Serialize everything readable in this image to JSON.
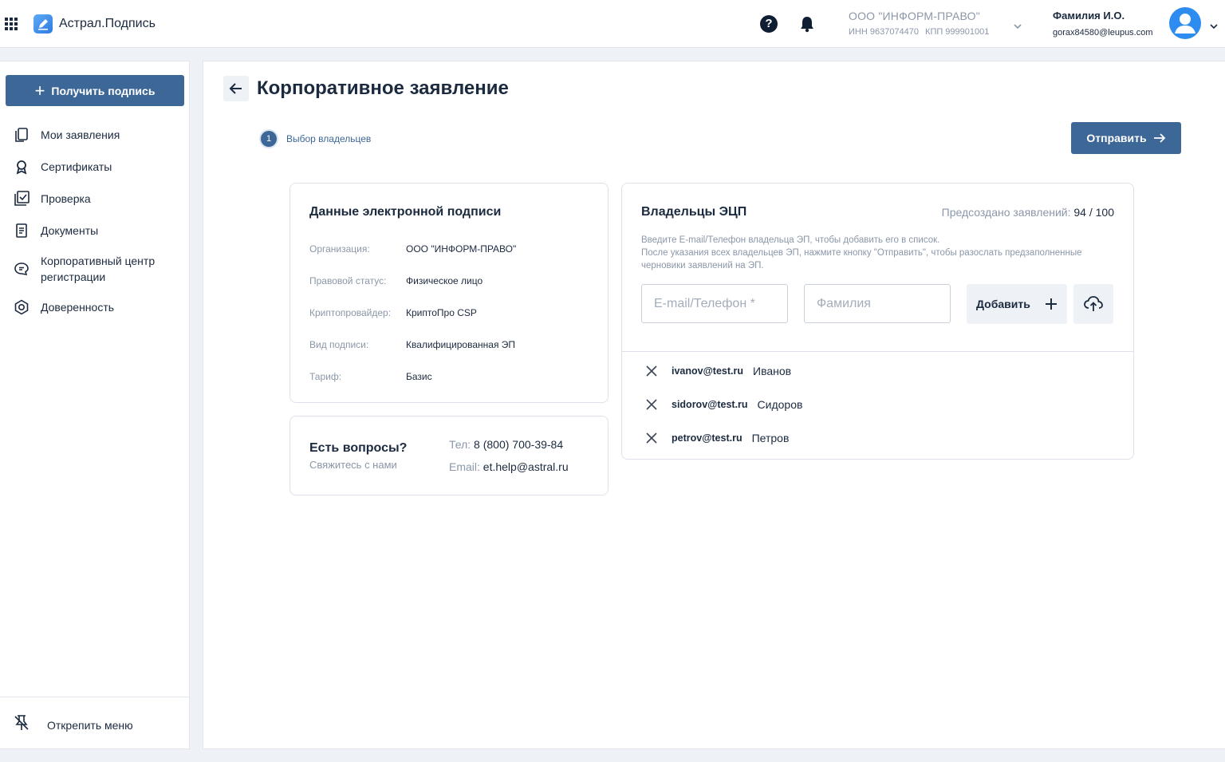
{
  "app": {
    "title": "Астрал.Подпись"
  },
  "header": {
    "org_name": "ООО \"ИНФОРМ-ПРАВО\"",
    "inn": "ИНН 9637074470",
    "kpp": "КПП 999901001",
    "user_name": "Фамилия И.О.",
    "user_email": "gorax84580@leupus.com",
    "icons": [
      "apps-grid-icon",
      "help-icon",
      "bell-icon",
      "chevron-down-icon",
      "avatar-icon"
    ]
  },
  "sidebar": {
    "primary_button": "Получить подпись",
    "items": [
      {
        "label": "Мои заявления",
        "icon": "documents-icon"
      },
      {
        "label": "Сертификаты",
        "icon": "certificate-icon"
      },
      {
        "label": "Проверка",
        "icon": "check-icon"
      },
      {
        "label": "Документы",
        "icon": "document-list-icon"
      },
      {
        "label": "Корпоративный центр регистрации",
        "icon": "chat-icon"
      },
      {
        "label": "Доверенность",
        "icon": "shield-icon"
      }
    ],
    "unpin_label": "Открепить меню"
  },
  "main": {
    "title": "Корпоративное заявление",
    "step": {
      "number": "1",
      "label": "Выбор владельцев"
    },
    "send_button": "Отправить"
  },
  "signature_card": {
    "title": "Данные электронной подписи",
    "rows": [
      {
        "key": "Организация:",
        "value": "ООО \"ИНФОРМ-ПРАВО\""
      },
      {
        "key": "Правовой статус:",
        "value": "Физическое лицо"
      },
      {
        "key": "Криптопровайдер:",
        "value": "КриптоПро CSP"
      },
      {
        "key": "Вид подписи:",
        "value": "Квалифицированная ЭП"
      },
      {
        "key": "Тариф:",
        "value": "Базис"
      }
    ]
  },
  "help_card": {
    "title": "Есть вопросы?",
    "subtitle": "Свяжитесь с нами",
    "phone_label": "Тел:",
    "phone": "8 (800) 700-39-84",
    "email_label": "Email:",
    "email": "et.help@astral.ru"
  },
  "owners_card": {
    "title": "Владельцы ЭЦП",
    "counter_label": "Предсоздано заявлений:",
    "counter_value": "94 / 100",
    "hint_line1": "Введите E-mail/Телефон владельца ЭП, чтобы добавить его в список.",
    "hint_line2": "После указания всех владельцев ЭП, нажмите кнопку \"Отправить\", чтобы разослать предзаполненные черновики заявлений на ЭП.",
    "email_placeholder": "E-mail/Телефон *",
    "email_value": "",
    "surname_placeholder": "Фамилия",
    "surname_value": "",
    "add_button": "Добавить",
    "owners": [
      {
        "email": "ivanov@test.ru",
        "surname": "Иванов"
      },
      {
        "email": "sidorov@test.ru",
        "surname": "Сидоров"
      },
      {
        "email": "petrov@test.ru",
        "surname": "Петров"
      }
    ]
  },
  "colors": {
    "primary": "#3d6797",
    "text": "#1b2a3f",
    "muted": "#8b97a8",
    "avatar": "#2d8cf0",
    "background": "#eef1f5"
  }
}
